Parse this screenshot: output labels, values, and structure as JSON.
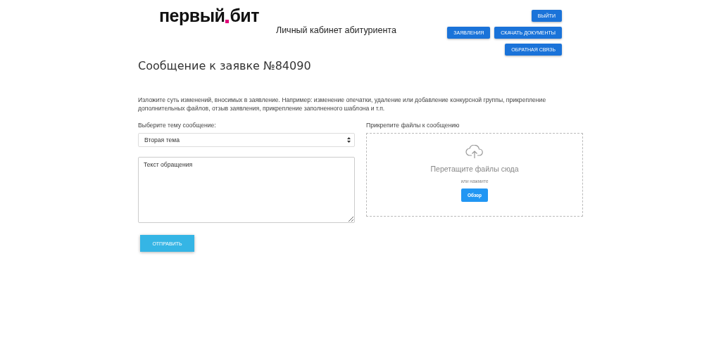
{
  "header": {
    "logo": {
      "left": "первый",
      "right": "бит"
    },
    "title": "Личный кабинет абитуриента",
    "buttons": [
      [
        "ВЫЙТИ"
      ],
      [
        "ЗАЯВЛЕНИЯ",
        "СКАЧАТЬ ДОКУМЕНТЫ"
      ],
      [
        "ОБРАТНАЯ СВЯЗЬ"
      ]
    ]
  },
  "heading": "Сообщение к заявке №84090",
  "instructions": "Изложите суть изменений, вносимых в заявление. Например: изменение опечатки, удаление или добавление конкурсной группы, прикрепление дополнительных файлов, отзыв заявления, прикрепление заполненного шаблона и т.п.",
  "topic": {
    "label": "Выберите тему сообщение:",
    "value": "Вторая тема"
  },
  "message": {
    "value": "Текст обращения"
  },
  "attachments": {
    "label": "Прикрепите файлы к сообщению",
    "drop_text": "Перетащите файлы сюда",
    "or_text": "или нажмите",
    "browse_button": "Обзор"
  },
  "submit_button": "ОТПРАВИТЬ"
}
